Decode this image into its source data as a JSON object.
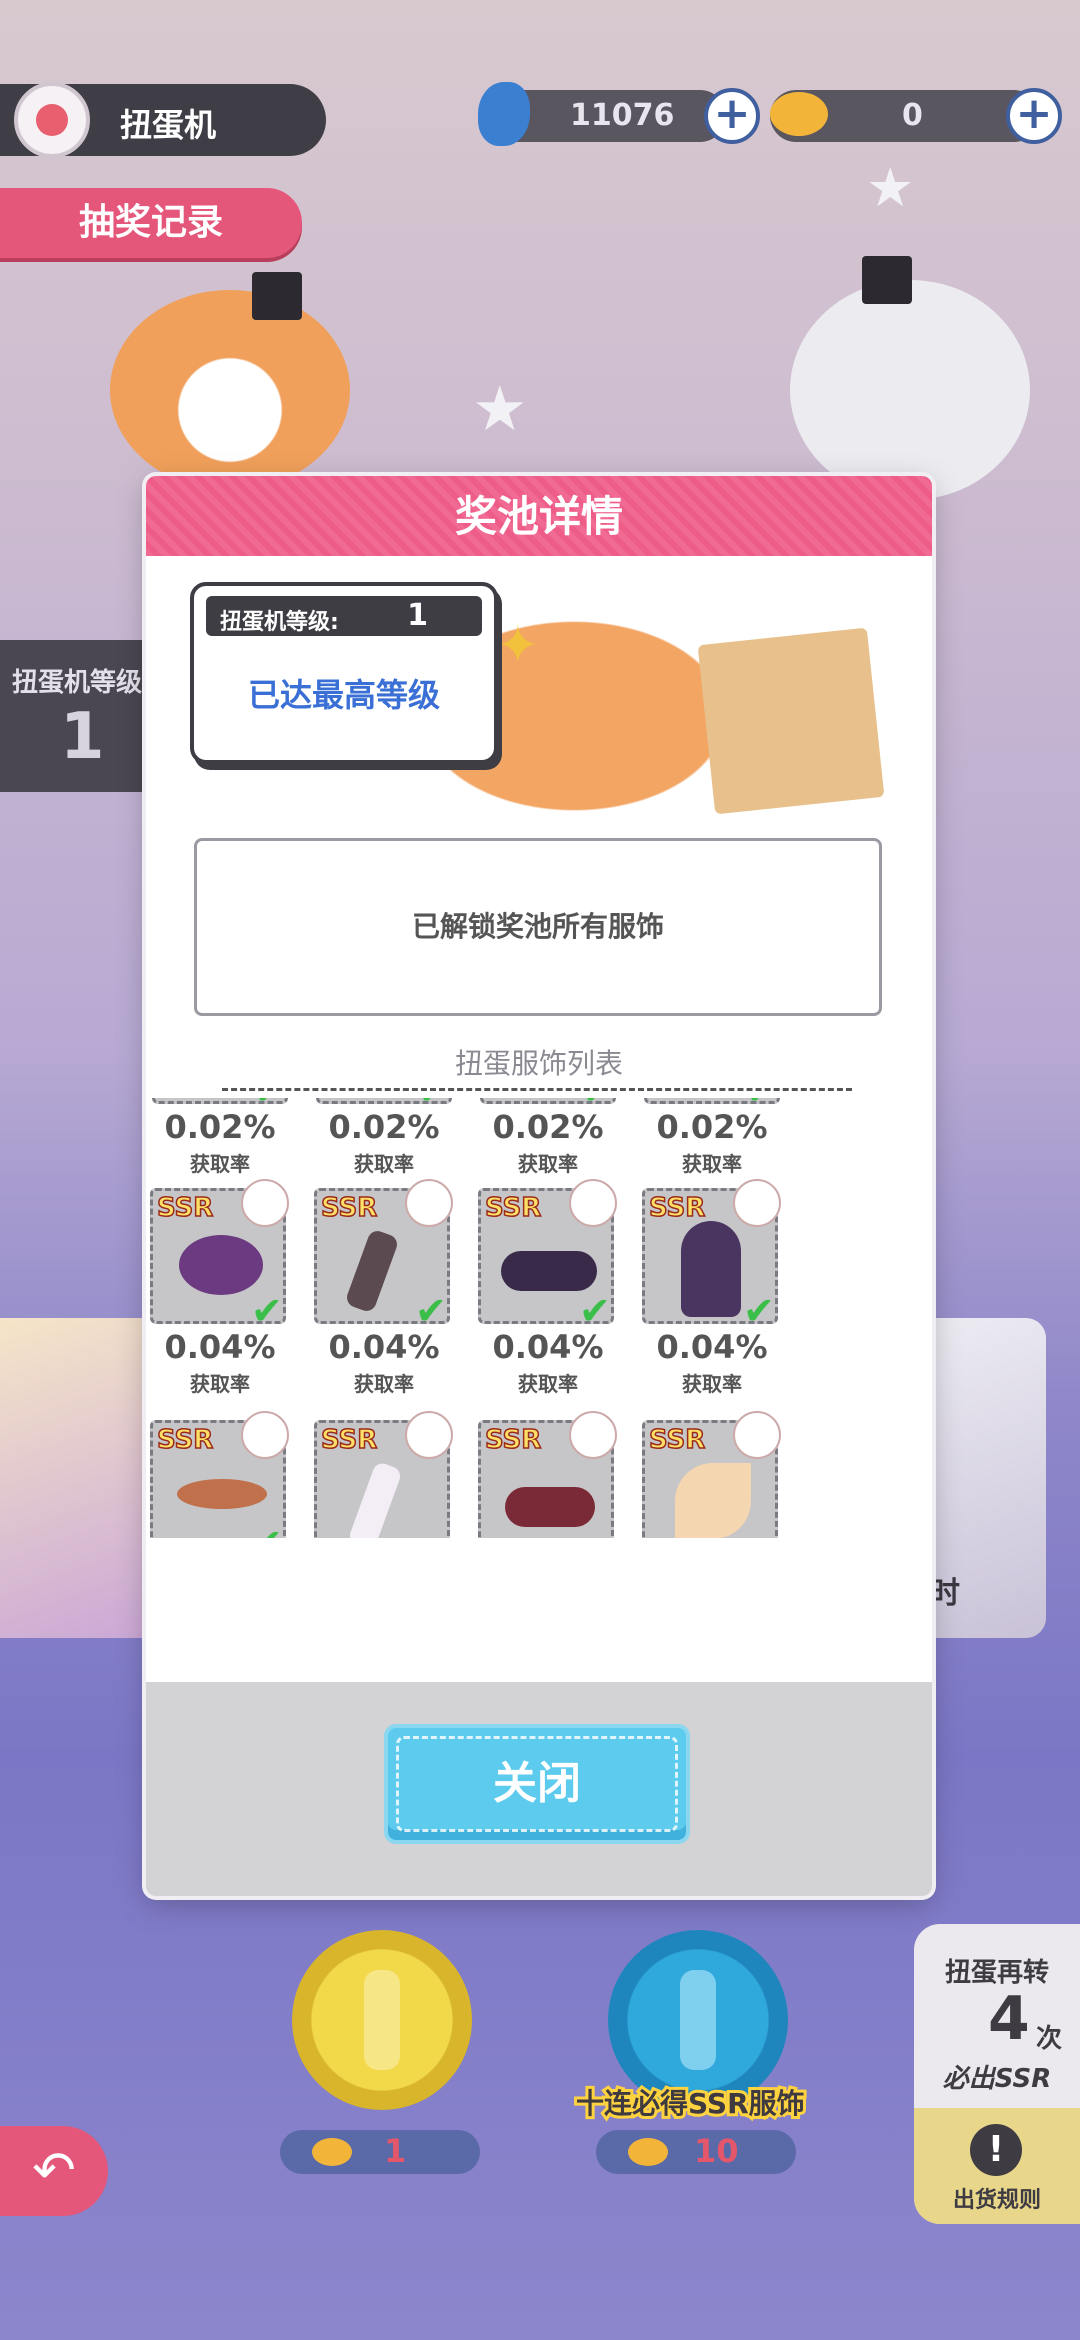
{
  "header": {
    "title": "扭蛋机",
    "currency1": "11076",
    "currency2": "0"
  },
  "record_button": "抽奖记录",
  "side_level": {
    "label": "扭蛋机等级",
    "value": "1"
  },
  "modal": {
    "title": "奖池详情",
    "level_label": "扭蛋机等级:",
    "level_value": "1",
    "level_status": "已达最高等级",
    "unlock_text": "已解锁奖池所有服饰",
    "list_title": "扭蛋服饰列表",
    "rate_label": "获取率",
    "row1_rates": [
      "0.02%",
      "0.02%",
      "0.02%",
      "0.02%"
    ],
    "row2": [
      {
        "tag": "SSR",
        "rate": "0.04%",
        "owned": true
      },
      {
        "tag": "SSR",
        "rate": "0.04%",
        "owned": true
      },
      {
        "tag": "SSR",
        "rate": "0.04%",
        "owned": true
      },
      {
        "tag": "SSR",
        "rate": "0.04%",
        "owned": true
      }
    ],
    "row3": [
      {
        "tag": "SSR",
        "owned": true
      },
      {
        "tag": "SSR",
        "owned": false
      },
      {
        "tag": "SSR",
        "owned": false
      },
      {
        "tag": "SSR",
        "owned": false
      }
    ],
    "close_button": "关闭"
  },
  "bottom": {
    "single_cost": "1",
    "ten_cost": "10",
    "ten_label": "十连必得SSR服饰",
    "spin_again": "扭蛋再转",
    "spin_count": "4",
    "spin_unit": "次",
    "spin_ssr": "必出SSR",
    "rules": "出货规则",
    "banner_text": "时"
  },
  "colors": {
    "accent_pink": "#f06a93",
    "close_blue": "#5ccbee",
    "level_blue": "#3a6fd6"
  }
}
